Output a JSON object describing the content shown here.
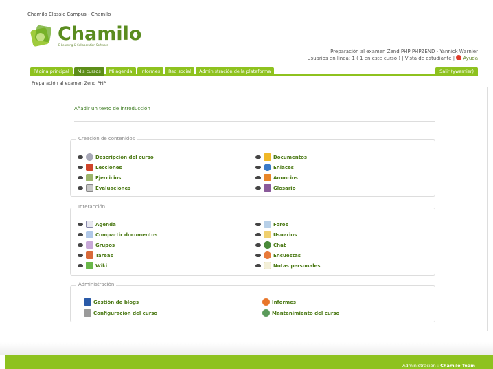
{
  "window_title": "Chamilo Classic Campus - Chamilo",
  "logo": {
    "word": "Chamilo",
    "tagline": "E-Learning & Collaboration Software"
  },
  "header": {
    "course_line": "Preparación al examen Zend PHP PHPZEND - Yannick Warnier",
    "users_line": "Usuarios en línea: 1 ( 1 en este curso ) |",
    "student_view": "Vista de estudiante",
    "sep": "|",
    "help": "Ayuda"
  },
  "nav": {
    "tabs": [
      "Página principal",
      "Mis cursos",
      "Mi agenda",
      "Informes",
      "Red social",
      "Administración de la plataforma"
    ],
    "active_tab": "Mis cursos",
    "logout": "Salir (ywarnier)"
  },
  "breadcrumb": "Preparación al examen Zend PHP",
  "intro_link": "Añadir un texto de introducción",
  "sections": {
    "content": {
      "title": "Creación de contenidos",
      "left": [
        "Descripción del curso",
        "Lecciones",
        "Ejercicios",
        "Evaluaciones"
      ],
      "right": [
        "Documentos",
        "Enlaces",
        "Anuncios",
        "Glosario"
      ]
    },
    "interaction": {
      "title": "Interacción",
      "left": [
        "Agenda",
        "Compartir documentos",
        "Grupos",
        "Tareas",
        "Wiki"
      ],
      "right": [
        "Foros",
        "Usuarios",
        "Chat",
        "Encuestas",
        "Notas personales"
      ]
    },
    "admin": {
      "title": "Administración",
      "left": [
        "Gestión de blogs",
        "Configuración del curso"
      ],
      "right": [
        "Informes",
        "Mantenimiento del curso"
      ]
    }
  },
  "footer": {
    "label": "Administración :",
    "team": "Chamilo Team"
  },
  "colors": {
    "accent": "#8ec21f",
    "accent_dark": "#5d8e18",
    "link": "#4c7a16"
  }
}
